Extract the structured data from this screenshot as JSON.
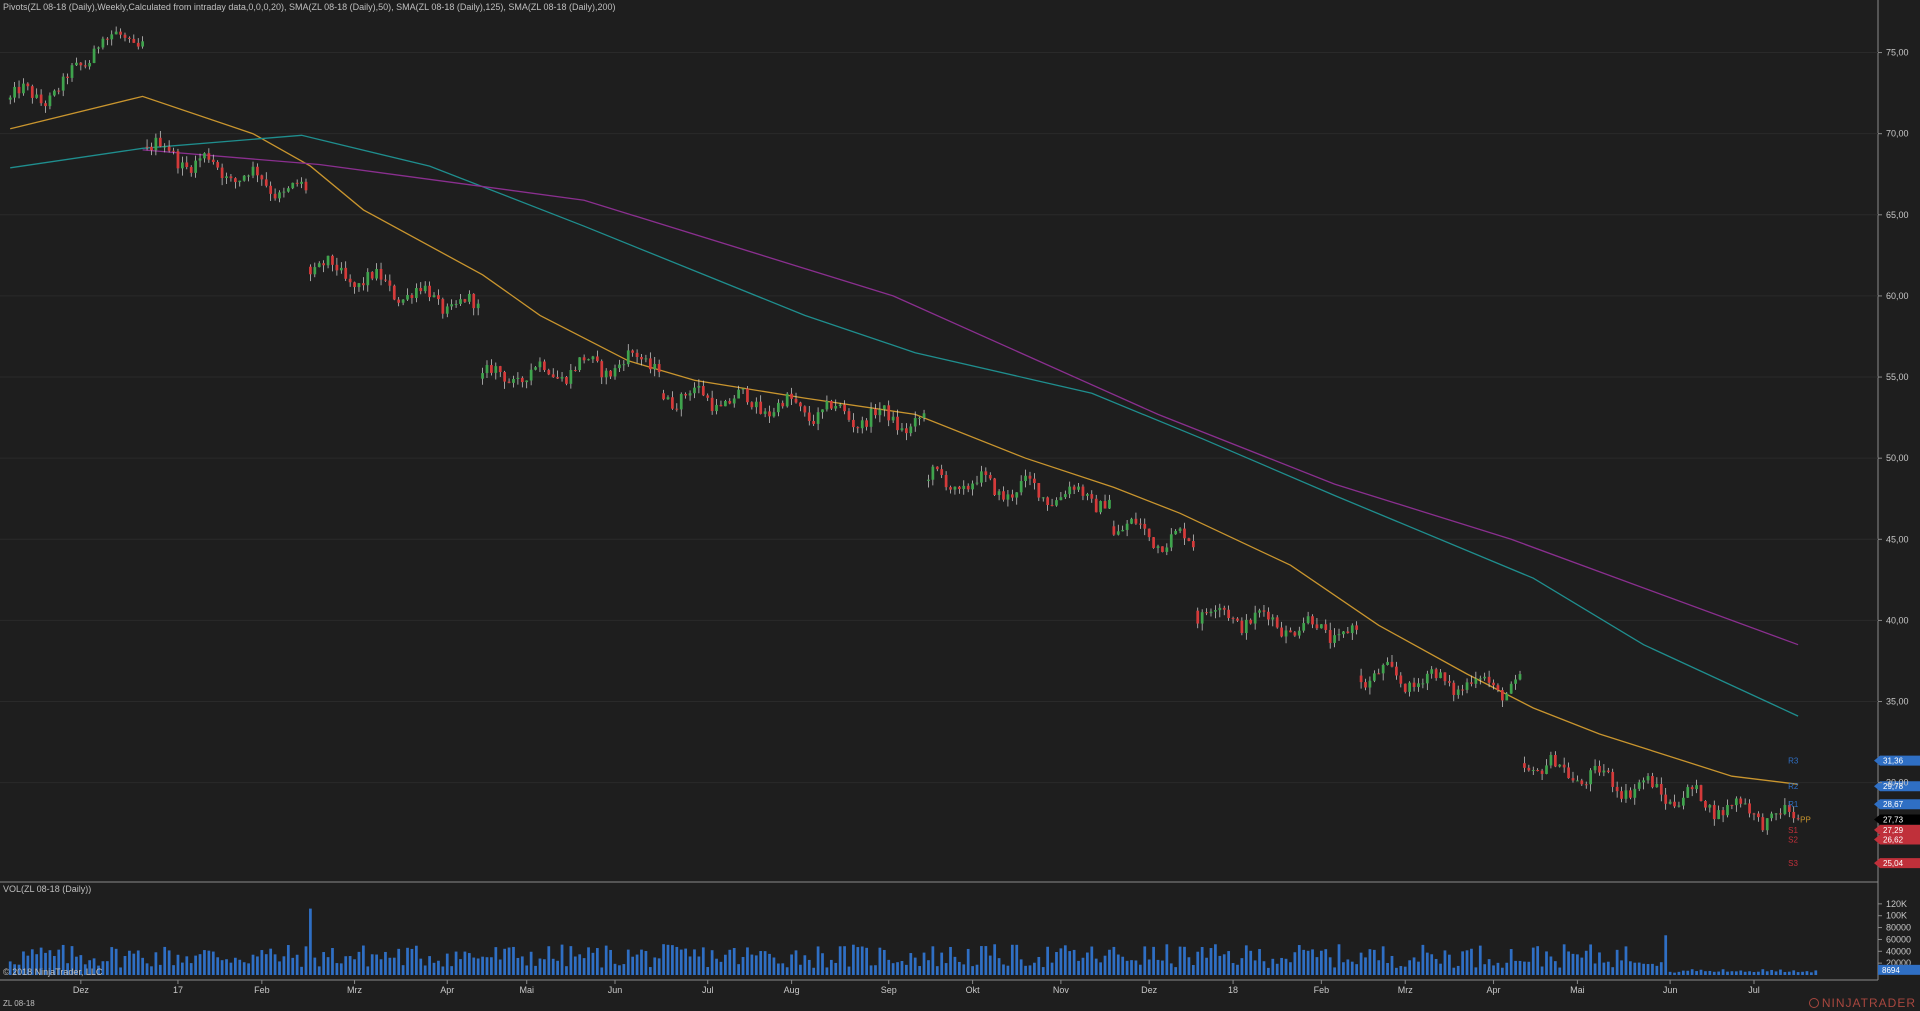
{
  "window": {
    "indicators_label": "Pivots(ZL 08-18 (Daily),Weekly,Calculated from intraday data,0,0,0,20), SMA(ZL 08-18 (Daily),50), SMA(ZL 08-18 (Daily),125), SMA(ZL 08-18 (Daily),200)",
    "volume_label": "VOL(ZL 08-18 (Daily))",
    "copyright": "© 2018 NinjaTrader, LLC",
    "instrument": "ZL 08-18",
    "brand": "NINJATRADER"
  },
  "colors": {
    "background": "#1e1e1e",
    "grid": "#2a2a2a",
    "up_candle": "#3fa34d",
    "down_candle": "#d43a3a",
    "sma50": "#c9952e",
    "sma125": "#1f8e8e",
    "sma200": "#8a2f8f",
    "volume": "#2f6fc4",
    "pivot_r": "#2f6fc4",
    "pivot_s": "#c0303a",
    "pivot_pp": "#c9952e"
  },
  "chart_data": [
    {
      "type": "candlestick",
      "name": "price",
      "ylim": [
        24.0,
        77.5
      ],
      "y_ticks": [
        "75,00",
        "70,00",
        "65,00",
        "60,00",
        "55,00",
        "50,00",
        "45,00",
        "40,00",
        "35,00",
        "30,00"
      ],
      "y_tick_values": [
        75,
        70,
        65,
        60,
        55,
        50,
        45,
        40,
        35,
        30
      ],
      "x_labels": [
        "Dez",
        "17",
        "Feb",
        "Mrz",
        "Apr",
        "Mai",
        "Jun",
        "Jul",
        "Aug",
        "Sep",
        "Okt",
        "Nov",
        "Dez",
        "18",
        "Feb",
        "Mrz",
        "Apr",
        "Mai",
        "Jun",
        "Jul"
      ],
      "bar_count": 410,
      "x_label_bars": [
        16,
        38,
        57,
        78,
        99,
        117,
        137,
        158,
        177,
        199,
        218,
        238,
        258,
        277,
        297,
        316,
        336,
        355,
        376,
        395
      ],
      "segments": [
        {
          "start": 0,
          "end": 31,
          "open": 72.1,
          "close": 73.5,
          "high_shape": "rally_to_75"
        },
        {
          "start": 31,
          "end": 68,
          "open": 69.2,
          "close": 66.2
        },
        {
          "start": 68,
          "end": 107,
          "open": 61.8,
          "close": 59.1
        },
        {
          "start": 107,
          "end": 148,
          "open": 54.9,
          "close": 56.1
        },
        {
          "start": 148,
          "end": 208,
          "open": 54.0,
          "close": 52.1
        },
        {
          "start": 208,
          "end": 250,
          "open": 48.6,
          "close": 47.5
        },
        {
          "start": 250,
          "end": 269,
          "open": 45.8,
          "close": 44.7
        },
        {
          "start": 269,
          "end": 306,
          "open": 40.6,
          "close": 39.1
        },
        {
          "start": 306,
          "end": 343,
          "open": 36.6,
          "close": 35.9
        },
        {
          "start": 343,
          "end": 406,
          "open": 31.2,
          "close": 27.6
        }
      ],
      "last_bar": 405
    },
    {
      "type": "line",
      "name": "SMA(ZL 08-18 (Daily),50)",
      "color_key": "sma50",
      "points": [
        [
          0,
          70.3
        ],
        [
          30,
          72.3
        ],
        [
          55,
          70.0
        ],
        [
          68,
          68.0
        ],
        [
          80,
          65.3
        ],
        [
          107,
          61.3
        ],
        [
          120,
          58.8
        ],
        [
          140,
          56.0
        ],
        [
          155,
          54.8
        ],
        [
          180,
          53.7
        ],
        [
          205,
          52.7
        ],
        [
          230,
          50.0
        ],
        [
          250,
          48.2
        ],
        [
          265,
          46.6
        ],
        [
          290,
          43.4
        ],
        [
          310,
          39.7
        ],
        [
          330,
          36.7
        ],
        [
          345,
          34.6
        ],
        [
          360,
          33.0
        ],
        [
          390,
          30.4
        ],
        [
          405,
          29.9
        ]
      ]
    },
    {
      "type": "line",
      "name": "SMA(ZL 08-18 (Daily),125)",
      "color_key": "sma125",
      "points": [
        [
          0,
          67.9
        ],
        [
          30,
          69.1
        ],
        [
          66,
          69.9
        ],
        [
          95,
          68.0
        ],
        [
          130,
          64.3
        ],
        [
          180,
          58.8
        ],
        [
          205,
          56.5
        ],
        [
          245,
          54.0
        ],
        [
          270,
          51.2
        ],
        [
          300,
          47.7
        ],
        [
          345,
          42.6
        ],
        [
          370,
          38.5
        ],
        [
          405,
          34.1
        ]
      ]
    },
    {
      "type": "line",
      "name": "SMA(ZL 08-18 (Daily),200)",
      "color_key": "sma200",
      "points": [
        [
          30,
          69.0
        ],
        [
          70,
          68.1
        ],
        [
          130,
          65.9
        ],
        [
          200,
          60.0
        ],
        [
          260,
          52.7
        ],
        [
          300,
          48.4
        ],
        [
          340,
          45.0
        ],
        [
          405,
          38.5
        ]
      ]
    },
    {
      "type": "bar",
      "name": "volume",
      "ylim": [
        0,
        140000
      ],
      "y_ticks": [
        "120K",
        "100K",
        "80000",
        "60000",
        "40000",
        "20000"
      ],
      "y_tick_values": [
        120000,
        100000,
        80000,
        60000,
        40000,
        20000
      ],
      "last_value_label": "8694",
      "last_value": 8694
    }
  ],
  "pivots": {
    "levels": [
      {
        "name": "R3",
        "value": 31.36,
        "label": "31,36",
        "kind": "r"
      },
      {
        "name": "R2",
        "value": 29.78,
        "label": "29,78",
        "kind": "r"
      },
      {
        "name": "R1",
        "value": 28.67,
        "label": "28,67",
        "kind": "r"
      },
      {
        "name": "PP",
        "value": 27.73,
        "label": "27,73",
        "kind": "current"
      },
      {
        "name": "S1",
        "value": 27.09,
        "label": "27,29",
        "kind": "s"
      },
      {
        "name": "S2",
        "value": 26.5,
        "label": "26,62",
        "kind": "s"
      },
      {
        "name": "S3",
        "value": 25.04,
        "label": "25,04",
        "kind": "s"
      }
    ],
    "markers": [
      "R3",
      "R2",
      "R1",
      "PP",
      "S1",
      "S2",
      "S3"
    ]
  }
}
